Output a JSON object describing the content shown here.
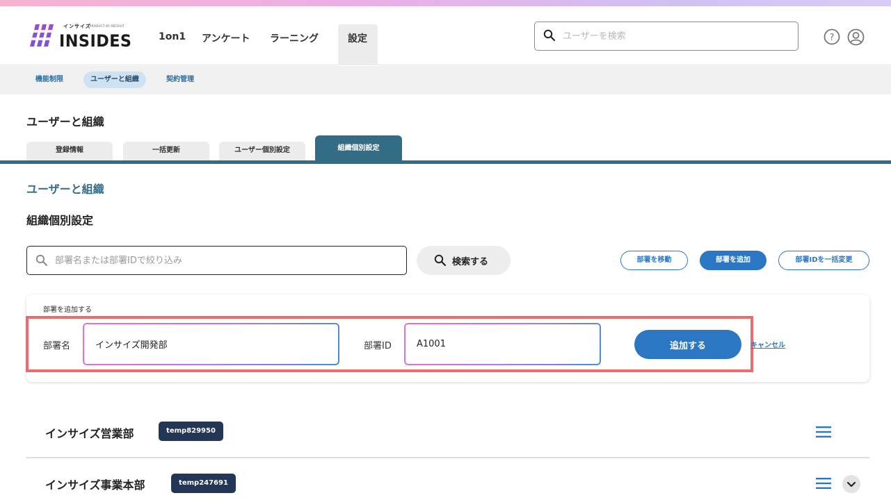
{
  "header": {
    "logo_small": "インサイズ",
    "logo_by": "PRODUCT BY RECRUIT",
    "logo_text": "INSIDES",
    "nav": [
      "1on1",
      "アンケート",
      "ラーニング",
      "設定"
    ],
    "search_placeholder": "ユーザーを検索"
  },
  "subnav": [
    "機能制限",
    "ユーザーと組織",
    "契約管理"
  ],
  "page_title": "ユーザーと組織",
  "tabs": [
    "登録情報",
    "一括更新",
    "ユーザー個別設定",
    "組織個別設定"
  ],
  "section_title": "ユーザーと組織",
  "sub_title": "組織個別設定",
  "filter": {
    "placeholder": "部署名または部署IDで絞り込み",
    "search_button": "検索する"
  },
  "actions": {
    "move": "部署を移動",
    "add": "部署を追加",
    "bulk_id": "部署IDを一括変更"
  },
  "add_form": {
    "title": "部署を追加する",
    "name_label": "部署名",
    "name_value": "インサイズ開発部",
    "id_label": "部署ID",
    "id_value": "A1001",
    "submit": "追加する",
    "cancel": "キャンセル"
  },
  "orgs": [
    {
      "name": "インサイズ営業部",
      "id": "temp829950"
    },
    {
      "name": "インサイズ事業本部",
      "id": "temp247691"
    }
  ],
  "colors": {
    "primary": "#2c77c4",
    "tab_active": "#336c85",
    "badge": "#243656",
    "highlight": "#ee6a6f"
  }
}
